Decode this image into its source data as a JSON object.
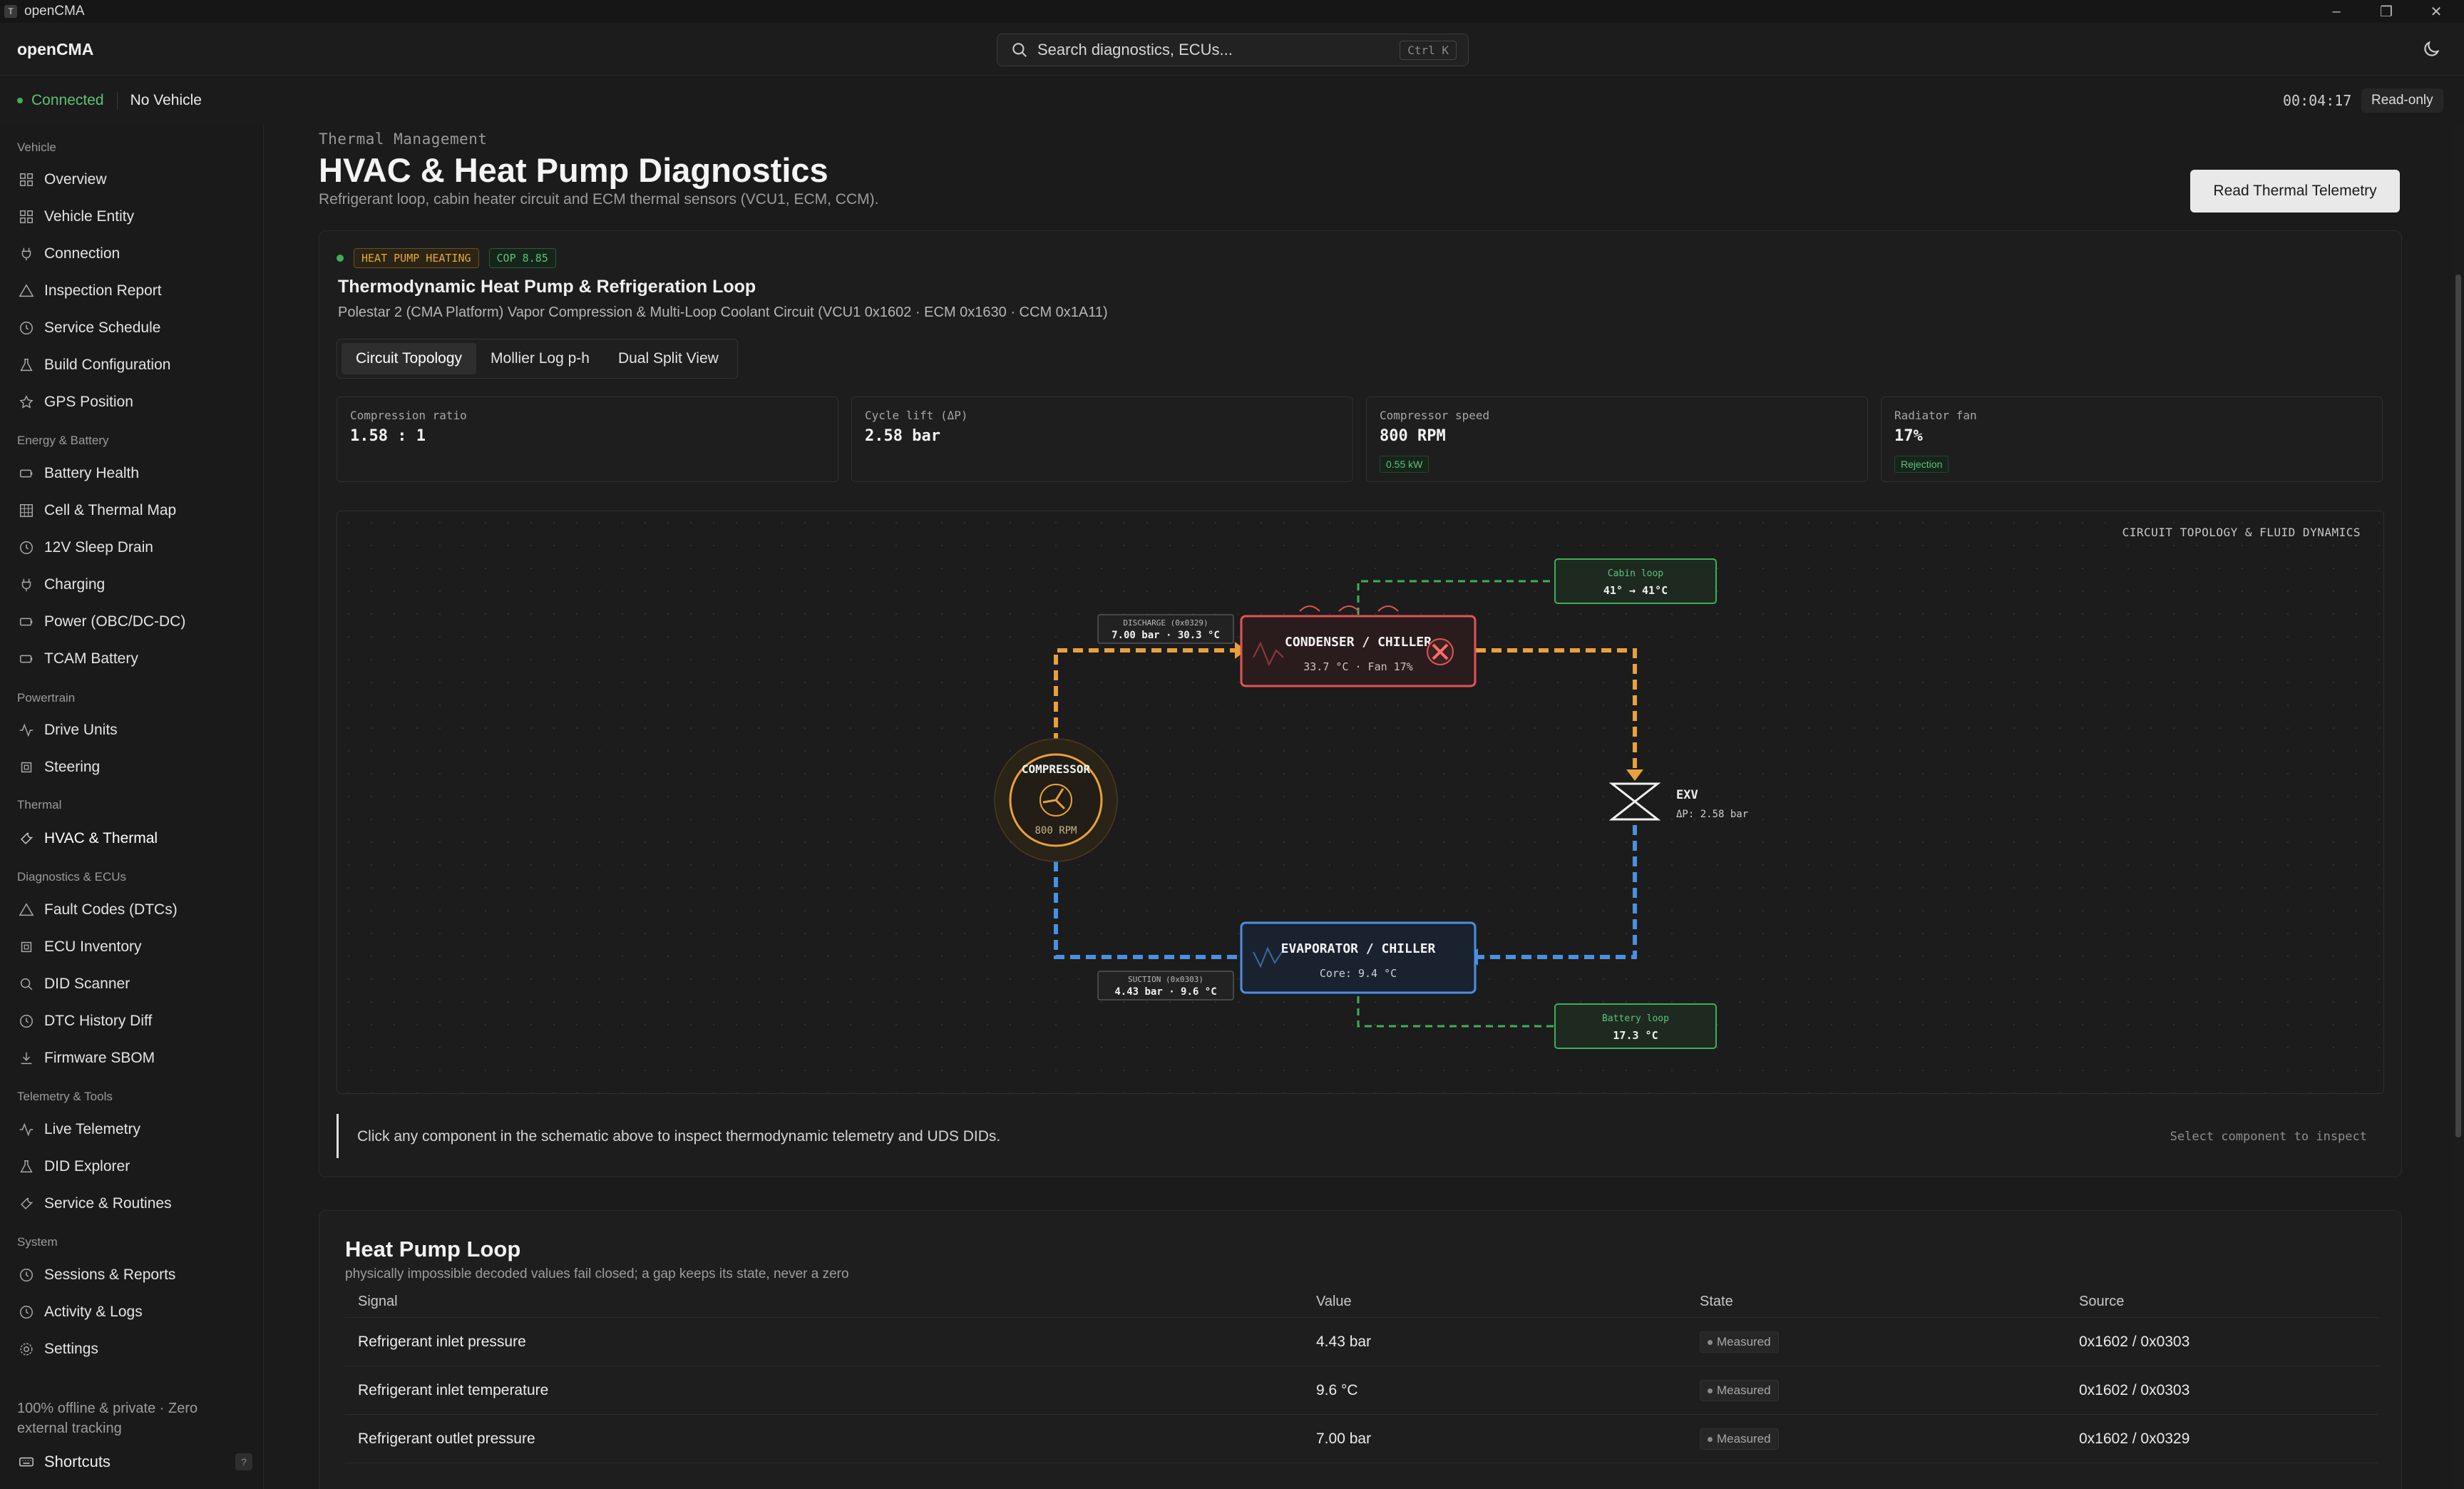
{
  "window": {
    "title": "openCMA",
    "icon_letter": "T"
  },
  "header": {
    "brand": "openCMA",
    "search_placeholder": "Search diagnostics, ECUs...",
    "search_shortcut": "Ctrl K"
  },
  "status": {
    "connection": "Connected",
    "vehicle": "No Vehicle",
    "timer": "00:04:17",
    "mode": "Read-only"
  },
  "sidebar": {
    "sections": [
      {
        "label": "Vehicle"
      },
      {
        "label": "Energy & Battery"
      },
      {
        "label": "Powertrain"
      },
      {
        "label": "Thermal"
      },
      {
        "label": "Diagnostics & ECUs"
      },
      {
        "label": "Telemetry & Tools"
      },
      {
        "label": "System"
      }
    ],
    "items": [
      {
        "label": "Overview",
        "icon": "grid-icon"
      },
      {
        "label": "Vehicle Entity",
        "icon": "grid-icon"
      },
      {
        "label": "Connection",
        "icon": "plug-icon"
      },
      {
        "label": "Inspection Report",
        "icon": "warning-icon"
      },
      {
        "label": "Service Schedule",
        "icon": "clock-icon"
      },
      {
        "label": "Build Configuration",
        "icon": "flask-icon"
      },
      {
        "label": "GPS Position",
        "icon": "star-icon"
      },
      {
        "label": "Battery Health",
        "icon": "battery-icon"
      },
      {
        "label": "Cell & Thermal Map",
        "icon": "grid-icon"
      },
      {
        "label": "12V Sleep Drain",
        "icon": "clock-icon"
      },
      {
        "label": "Charging",
        "icon": "plug-icon"
      },
      {
        "label": "Power (OBC/DC-DC)",
        "icon": "battery-icon"
      },
      {
        "label": "TCAM Battery",
        "icon": "battery-icon"
      },
      {
        "label": "Drive Units",
        "icon": "activity-icon"
      },
      {
        "label": "Steering",
        "icon": "chip-icon"
      },
      {
        "label": "HVAC & Thermal",
        "icon": "wrench-icon"
      },
      {
        "label": "Fault Codes (DTCs)",
        "icon": "warning-icon"
      },
      {
        "label": "ECU Inventory",
        "icon": "chip-icon"
      },
      {
        "label": "DID Scanner",
        "icon": "search-icon"
      },
      {
        "label": "DTC History Diff",
        "icon": "clock-icon"
      },
      {
        "label": "Firmware SBOM",
        "icon": "download-icon"
      },
      {
        "label": "Live Telemetry",
        "icon": "activity-icon"
      },
      {
        "label": "DID Explorer",
        "icon": "flask-icon"
      },
      {
        "label": "Service & Routines",
        "icon": "wrench-icon"
      },
      {
        "label": "Sessions & Reports",
        "icon": "clock-icon"
      },
      {
        "label": "Activity & Logs",
        "icon": "clock-icon"
      },
      {
        "label": "Settings",
        "icon": "gear-icon"
      }
    ],
    "footer": "100% offline & private · Zero external tracking",
    "shortcuts": "Shortcuts",
    "shortcuts_key": "?"
  },
  "page": {
    "eyebrow": "Thermal Management",
    "title": "HVAC & Heat Pump Diagnostics",
    "subtitle": "Refrigerant loop, cabin heater circuit and ECM thermal sensors (VCU1, ECM, CCM).",
    "action": "Read Thermal Telemetry"
  },
  "card": {
    "badge_mode": "HEAT PUMP HEATING",
    "badge_cop": "COP 8.85",
    "title": "Thermodynamic Heat Pump & Refrigeration Loop",
    "subtitle": "Polestar 2 (CMA Platform) Vapor Compression & Multi-Loop Coolant Circuit (VCU1 0x1602 · ECM 0x1630 · CCM 0x1A11)",
    "tabs": [
      "Circuit Topology",
      "Mollier Log p-h",
      "Dual Split View"
    ],
    "metrics": [
      {
        "label": "Compression ratio",
        "value": "1.58 : 1",
        "chip": ""
      },
      {
        "label": "Cycle lift (ΔP)",
        "value": "2.58 bar",
        "chip": ""
      },
      {
        "label": "Compressor speed",
        "value": "800 RPM",
        "chip": "0.55 kW"
      },
      {
        "label": "Radiator fan",
        "value": "17%",
        "chip": "Rejection"
      }
    ],
    "schematic": {
      "label": "CIRCUIT TOPOLOGY & FLUID DYNAMICS",
      "compressor_title": "COMPRESSOR",
      "compressor_rpm": "800 RPM",
      "condenser_title": "CONDENSER / CHILLER",
      "condenser_sub": "33.7 °C · Fan 17%",
      "evaporator_title": "EVAPORATOR / CHILLER",
      "evaporator_sub": "Core: 9.4 °C",
      "exv_title": "EXV",
      "exv_sub": "ΔP: 2.58 bar",
      "discharge_label": "DISCHARGE (0x0329)",
      "discharge_value": "7.00 bar · 30.3 °C",
      "suction_label": "SUCTION (0x0303)",
      "suction_value": "4.43 bar · 9.6 °C",
      "cabin_label": "Cabin loop",
      "cabin_value": "41° → 41°C",
      "battery_label": "Battery loop",
      "battery_value": "17.3 °C",
      "colors": {
        "hot": "#e8a13a",
        "cold": "#4a90e2",
        "coolant": "#3fae5a",
        "condenser": "#e05555"
      }
    },
    "inspect_message": "Click any component in the schematic above to inspect thermodynamic telemetry and UDS DIDs.",
    "inspect_hint": "Select component to inspect"
  },
  "loop": {
    "title": "Heat Pump Loop",
    "subtitle": "physically impossible decoded values fail closed; a gap keeps its state, never a zero",
    "columns": [
      "Signal",
      "Value",
      "State",
      "Source"
    ],
    "rows": [
      {
        "signal": "Refrigerant inlet pressure",
        "value": "4.43 bar",
        "state": "Measured",
        "source": "0x1602 / 0x0303"
      },
      {
        "signal": "Refrigerant inlet temperature",
        "value": "9.6 °C",
        "state": "Measured",
        "source": "0x1602 / 0x0303"
      },
      {
        "signal": "Refrigerant outlet pressure",
        "value": "7.00 bar",
        "state": "Measured",
        "source": "0x1602 / 0x0329"
      }
    ]
  }
}
